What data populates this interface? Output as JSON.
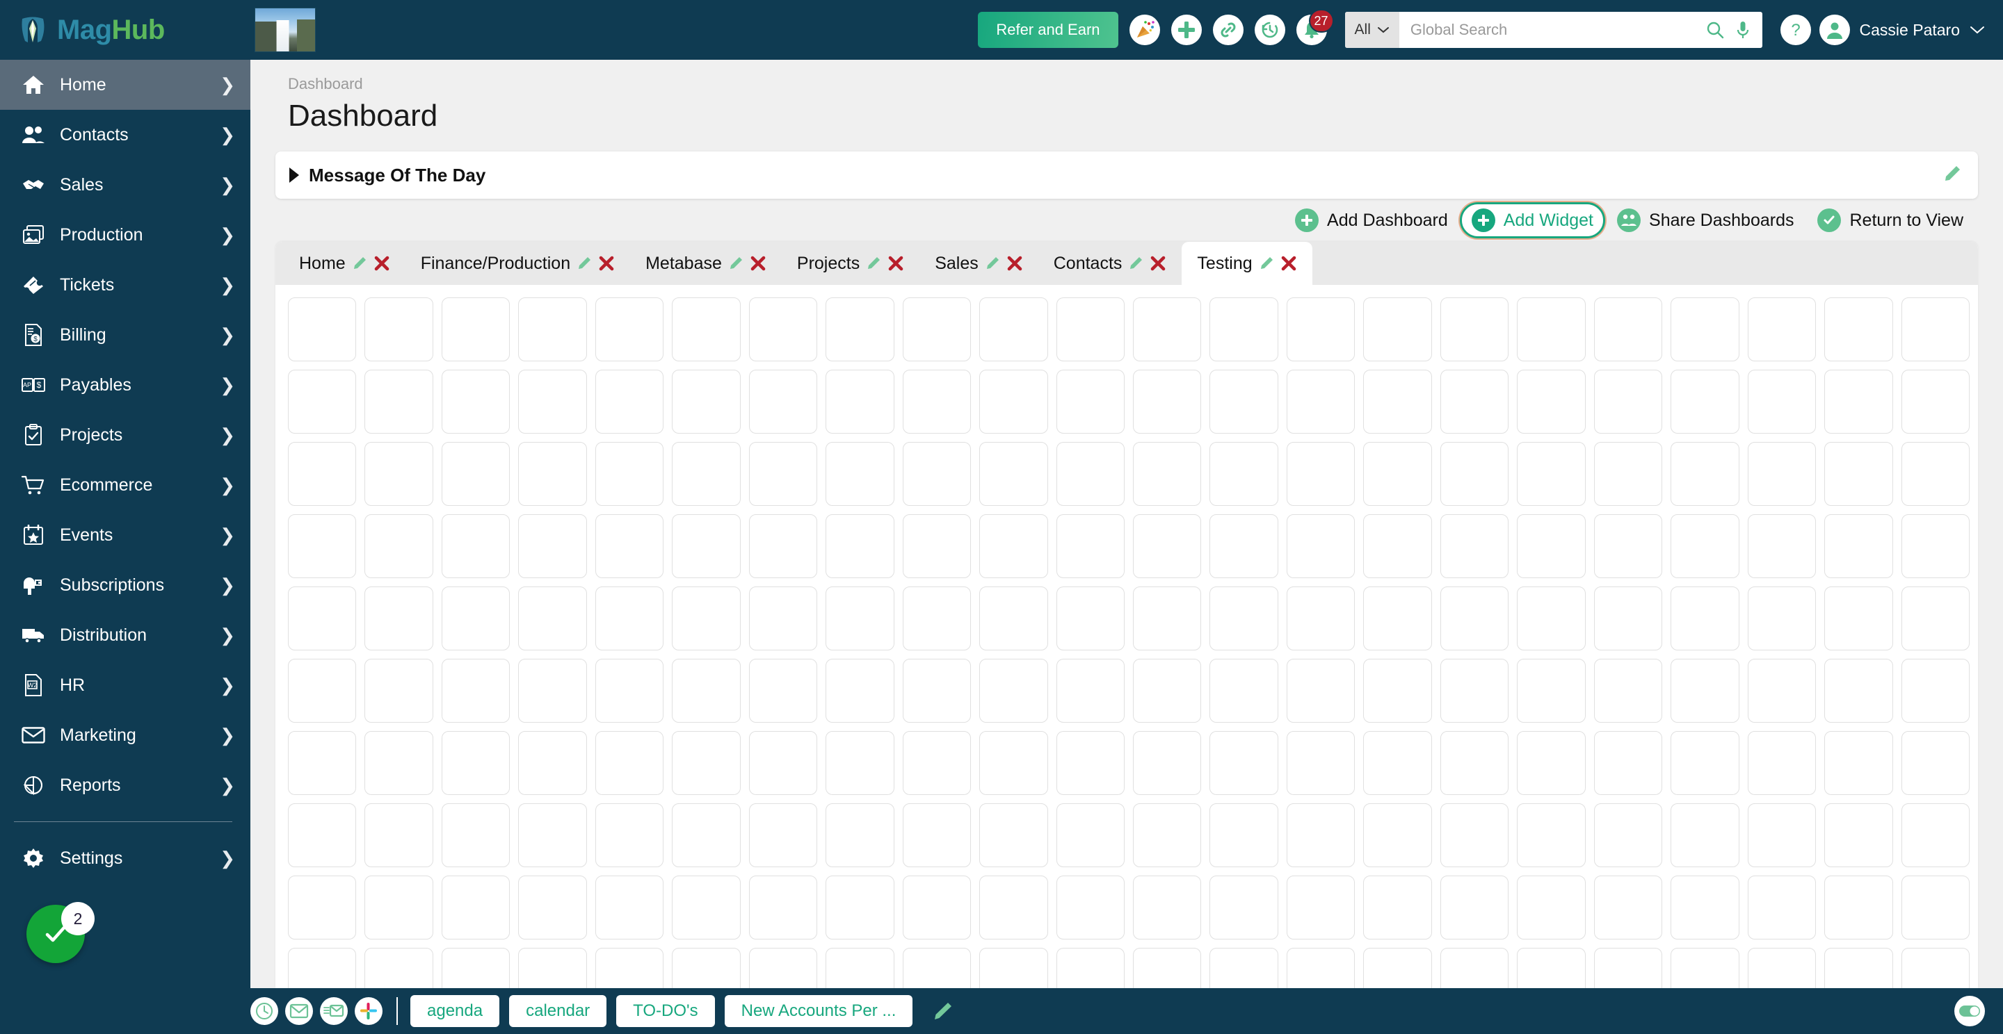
{
  "brand": {
    "mag": "Mag",
    "hub": "Hub",
    "logo_icon": "dragon-logo-icon",
    "thumbnail_icon": "waterfall-thumbnail"
  },
  "topbar": {
    "refer_label": "Refer and Earn",
    "icons": [
      {
        "name": "party-popper-icon"
      },
      {
        "name": "plus-icon"
      },
      {
        "name": "link-icon"
      },
      {
        "name": "history-clock-icon"
      },
      {
        "name": "bell-icon",
        "badge": "27"
      }
    ],
    "search": {
      "scope": "All",
      "placeholder": "Global Search",
      "value": "",
      "search_icon": "search-icon",
      "mic_icon": "microphone-icon"
    },
    "help_icon": "question-mark-icon",
    "user": {
      "name": "Cassie Pataro",
      "avatar_icon": "user-avatar-icon",
      "caret": "chevron-down-icon"
    }
  },
  "sidebar": {
    "items": [
      {
        "label": "Home",
        "icon": "home-icon",
        "active": true
      },
      {
        "label": "Contacts",
        "icon": "contacts-icon",
        "active": false
      },
      {
        "label": "Sales",
        "icon": "handshake-icon",
        "active": false
      },
      {
        "label": "Production",
        "icon": "image-stack-icon",
        "active": false
      },
      {
        "label": "Tickets",
        "icon": "ticket-icon",
        "active": false
      },
      {
        "label": "Billing",
        "icon": "invoice-dollar-icon",
        "active": false
      },
      {
        "label": "Payables",
        "icon": "money-bills-icon",
        "active": false
      },
      {
        "label": "Projects",
        "icon": "clipboard-check-icon",
        "active": false
      },
      {
        "label": "Ecommerce",
        "icon": "shopping-cart-icon",
        "active": false
      },
      {
        "label": "Events",
        "icon": "calendar-star-icon",
        "active": false
      },
      {
        "label": "Subscriptions",
        "icon": "mailbox-icon",
        "active": false
      },
      {
        "label": "Distribution",
        "icon": "truck-icon",
        "active": false
      },
      {
        "label": "HR",
        "icon": "w2-document-icon",
        "active": false
      },
      {
        "label": "Marketing",
        "icon": "envelope-icon",
        "active": false
      },
      {
        "label": "Reports",
        "icon": "pie-chart-icon",
        "active": false
      }
    ],
    "settings": {
      "label": "Settings",
      "icon": "gear-icon"
    },
    "fab": {
      "icon": "check-icon",
      "badge": "2"
    }
  },
  "main": {
    "breadcrumb": "Dashboard",
    "title": "Dashboard",
    "motd": {
      "title": "Message Of The Day",
      "caret_icon": "triangle-right-icon",
      "edit_icon": "pencil-icon"
    },
    "actions": [
      {
        "label": "Add Dashboard",
        "icon": "plus-circle-icon",
        "highlighted": false
      },
      {
        "label": "Add Widget",
        "icon": "plus-circle-icon",
        "highlighted": true
      },
      {
        "label": "Share Dashboards",
        "icon": "share-users-icon",
        "highlighted": false
      },
      {
        "label": "Return to View",
        "icon": "check-circle-icon",
        "highlighted": false
      }
    ],
    "tabs": [
      {
        "label": "Home",
        "active": false
      },
      {
        "label": "Finance/Production",
        "active": false
      },
      {
        "label": "Metabase",
        "active": false
      },
      {
        "label": "Projects",
        "active": false
      },
      {
        "label": "Sales",
        "active": false
      },
      {
        "label": "Contacts",
        "active": false
      },
      {
        "label": "Testing",
        "active": true
      }
    ],
    "tab_edit_icon": "pencil-icon",
    "tab_delete_icon": "close-x-icon",
    "grid": {
      "columns": 22,
      "rows": 10
    }
  },
  "bottombar": {
    "icons": [
      {
        "name": "clock-icon"
      },
      {
        "name": "envelope-icon"
      },
      {
        "name": "envelope-list-icon"
      },
      {
        "name": "slack-icon"
      }
    ],
    "chips": [
      {
        "label": "agenda"
      },
      {
        "label": "calendar"
      },
      {
        "label": "TO-DO's"
      },
      {
        "label": "New Accounts Per ..."
      }
    ],
    "edit_icon": "pencil-icon",
    "toggle_icon": "toggle-on-icon"
  },
  "colors": {
    "navy": "#0f3b52",
    "green_accent": "#17a77e",
    "light_green": "#5cc08e",
    "red": "#b81f2b",
    "active_nav": "#5a6b7a"
  }
}
